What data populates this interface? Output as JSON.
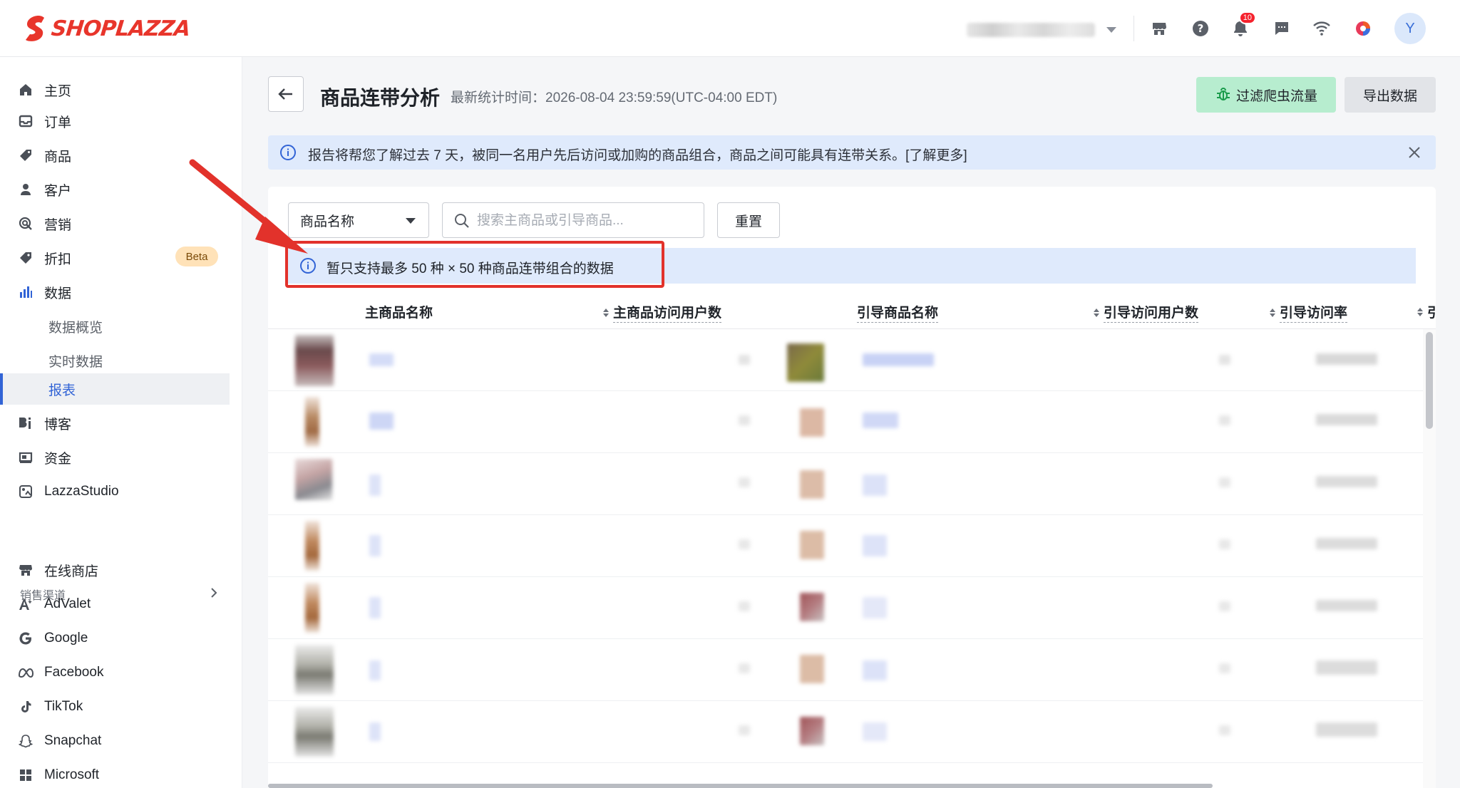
{
  "brand": {
    "name": "SHOPLAZZA",
    "color": "#e8352b"
  },
  "topbar": {
    "icons": [
      "store-icon",
      "help-icon",
      "bell-icon",
      "message-icon",
      "wifi-icon",
      "color-wheel-icon"
    ],
    "notification_count": "10",
    "avatar_initial": "Y"
  },
  "sidebar": {
    "items": [
      {
        "label": "主页",
        "icon": "home-icon"
      },
      {
        "label": "订单",
        "icon": "inbox-icon"
      },
      {
        "label": "商品",
        "icon": "tag-icon"
      },
      {
        "label": "客户",
        "icon": "person-icon"
      },
      {
        "label": "营销",
        "icon": "marketing-icon"
      },
      {
        "label": "折扣",
        "icon": "discount-icon",
        "badge": "Beta"
      },
      {
        "label": "数据",
        "icon": "bar-chart-icon"
      }
    ],
    "data_subitems": [
      {
        "label": "数据概览"
      },
      {
        "label": "实时数据"
      },
      {
        "label": "报表",
        "active": true
      }
    ],
    "items_after": [
      {
        "label": "博客",
        "icon": "blog-icon"
      },
      {
        "label": "资金",
        "icon": "finance-icon"
      },
      {
        "label": "LazzaStudio",
        "icon": "studio-icon"
      }
    ],
    "section_title": "销售渠道",
    "channels": [
      {
        "label": "在线商店",
        "icon": "store-icon"
      },
      {
        "label": "AdValet",
        "icon": "advalet-icon"
      },
      {
        "label": "Google",
        "icon": "google-icon"
      },
      {
        "label": "Facebook",
        "icon": "meta-icon"
      },
      {
        "label": "TikTok",
        "icon": "tiktok-icon"
      },
      {
        "label": "Snapchat",
        "icon": "snapchat-icon"
      },
      {
        "label": "Microsoft",
        "icon": "microsoft-icon"
      }
    ]
  },
  "header": {
    "title": "商品连带分析",
    "stat_time": "最新统计时间：2026-08-04 23:59:59(UTC-04:00 EDT)",
    "filter_button": "过滤爬虫流量",
    "export_button": "导出数据"
  },
  "banner": {
    "text": "报告将帮您了解过去 7 天，被同一名用户先后访问或加购的商品组合，商品之间可能具有连带关系。[了解更多]"
  },
  "filters": {
    "select_value": "商品名称",
    "search_placeholder": "搜索主商品或引导商品...",
    "reset_button": "重置"
  },
  "limit_notice": "暂只支持最多 50 种 × 50 种商品连带组合的数据",
  "table": {
    "columns": [
      {
        "label": "主商品名称"
      },
      {
        "label": "主商品访问用户数"
      },
      {
        "label": "引导商品名称"
      },
      {
        "label": "引导访问用户数"
      },
      {
        "label": "引导访问率"
      },
      {
        "label": "引"
      }
    ]
  },
  "colors": {
    "accent": "#3264d6",
    "info_bg": "#dfeafc",
    "filter_btn": "#b7edcf",
    "annotation": "#e2322b"
  }
}
